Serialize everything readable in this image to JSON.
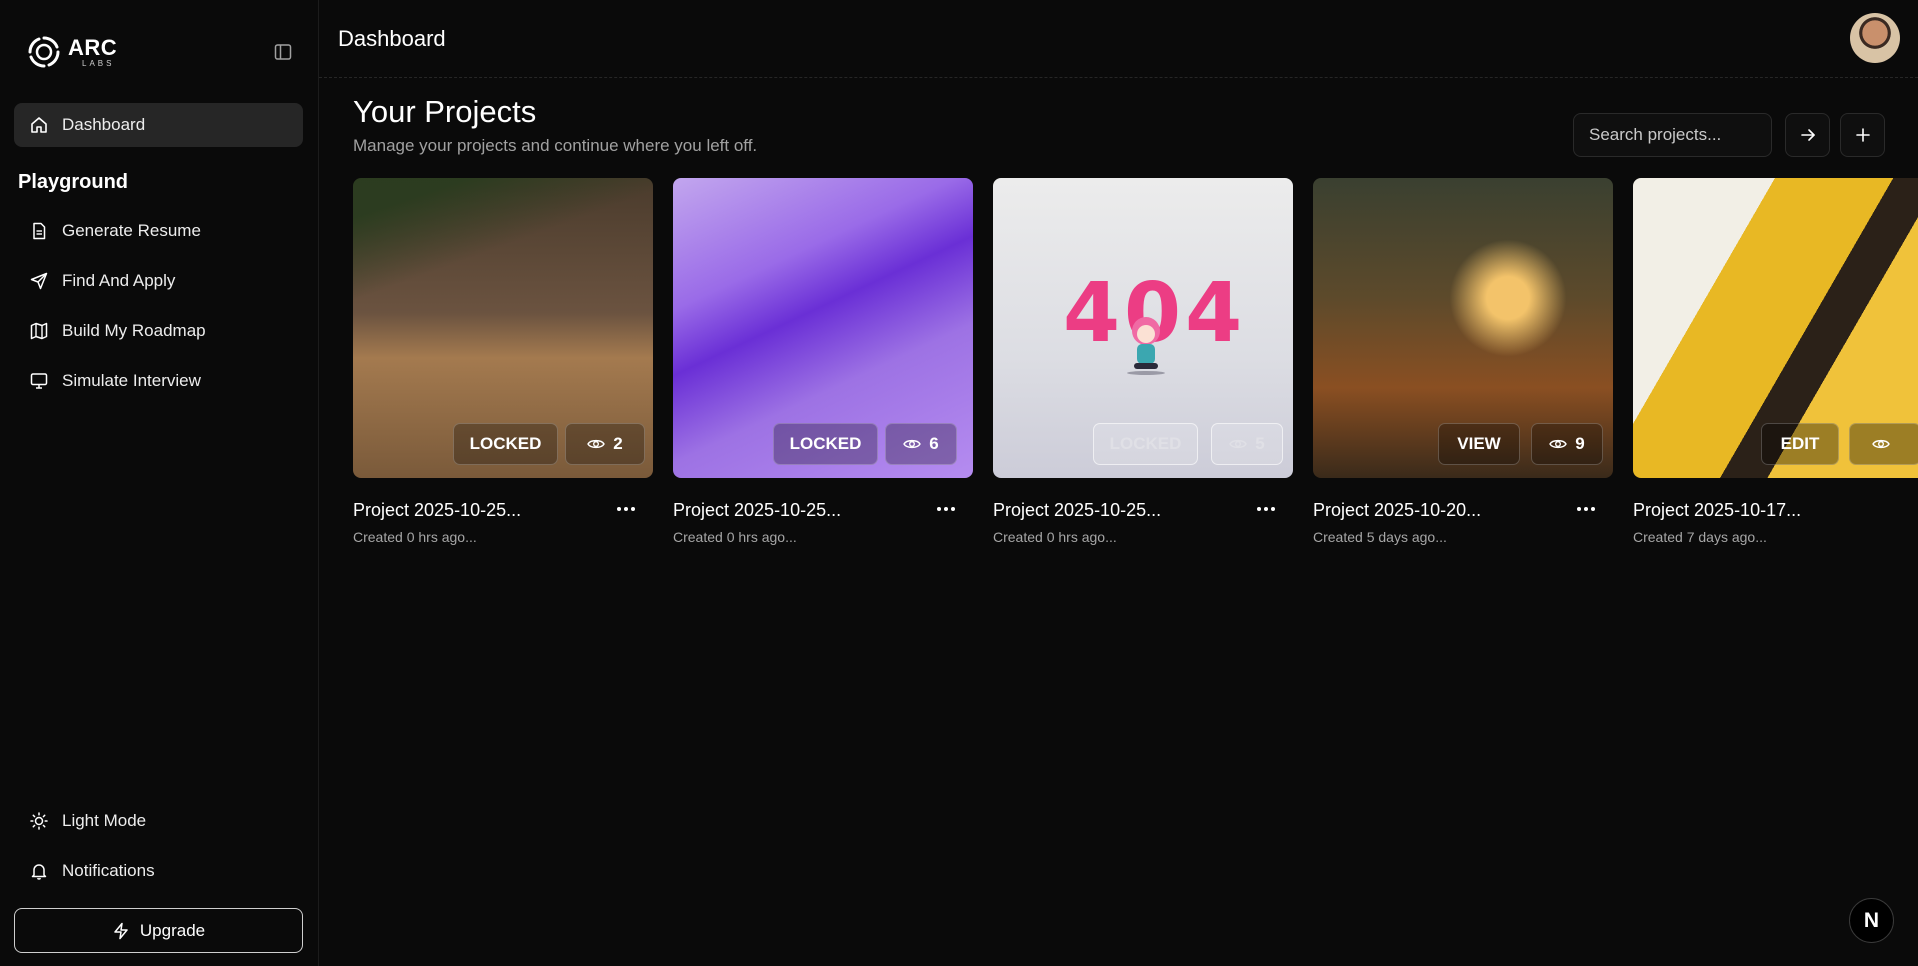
{
  "brand": {
    "name": "ARC",
    "sub": "LABS"
  },
  "sidebar": {
    "items": [
      {
        "label": "Dashboard",
        "icon": "home-icon"
      },
      {
        "label": "Generate Resume",
        "icon": "file-text-icon"
      },
      {
        "label": "Find And Apply",
        "icon": "send-icon"
      },
      {
        "label": "Build My Roadmap",
        "icon": "map-icon"
      },
      {
        "label": "Simulate Interview",
        "icon": "monitor-icon"
      }
    ],
    "section_title": "Playground",
    "footer": [
      {
        "label": "Light Mode",
        "icon": "sun-icon"
      },
      {
        "label": "Notifications",
        "icon": "bell-icon"
      }
    ],
    "upgrade_label": "Upgrade"
  },
  "header": {
    "title": "Dashboard"
  },
  "main": {
    "title": "Your Projects",
    "subtitle": "Manage your projects and continue where you left off.",
    "search_placeholder": "Search projects..."
  },
  "projects": [
    {
      "title": "Project 2025-10-25...",
      "meta": "Created 0 hrs ago...",
      "status": "LOCKED",
      "views": "2"
    },
    {
      "title": "Project 2025-10-25...",
      "meta": "Created 0 hrs ago...",
      "status": "LOCKED",
      "views": "6"
    },
    {
      "title": "Project 2025-10-25...",
      "meta": "Created 0 hrs ago...",
      "status": "LOCKED",
      "views": "5",
      "image_text": "404"
    },
    {
      "title": "Project 2025-10-20...",
      "meta": "Created 5 days ago...",
      "status": "VIEW",
      "views": "9"
    },
    {
      "title": "Project 2025-10-17...",
      "meta": "Created 7 days ago...",
      "status": "EDIT",
      "views": ""
    }
  ],
  "corner_badge": "N"
}
